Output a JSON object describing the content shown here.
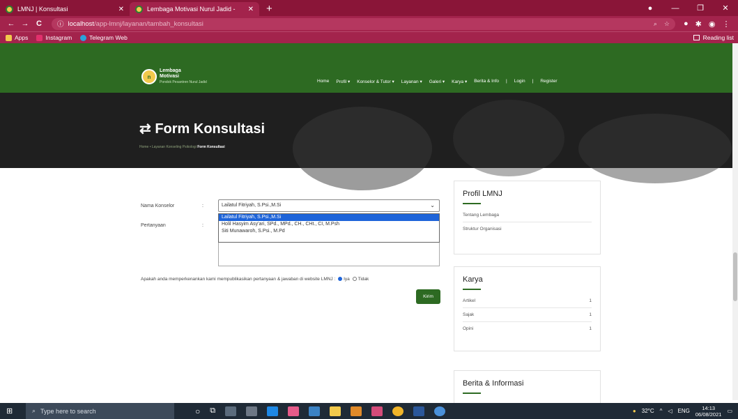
{
  "browser": {
    "tabs": [
      {
        "title": "LMNJ | Konsultasi"
      },
      {
        "title": "Lembaga Motivasi Nurul Jadid - "
      }
    ],
    "address": {
      "host": "localhost",
      "path": "/app-lmnj/layanan/tambah_konsultasi"
    },
    "bookmarks": [
      {
        "label": "Apps",
        "color": "#f2c94c"
      },
      {
        "label": "Instagram",
        "color": "#e1306c"
      },
      {
        "label": "Telegram Web",
        "color": "#2aa1da"
      }
    ],
    "reading_list": "Reading list"
  },
  "site": {
    "logo": {
      "line1": "Lembaga",
      "line2": "Motivasi",
      "line3": "Pondok Pesantren Nurul Jadid"
    },
    "menu": [
      "Home",
      "Profil ▾",
      "Konselor & Tutor ▾",
      "Layanan ▾",
      "Galeri ▾",
      "Karya ▾",
      "Berita & Info",
      "|",
      "Login",
      "|",
      "Register"
    ],
    "hero_title": "⇄ Form Konsultasi",
    "breadcrumb": {
      "prefix": "Home • Layanan Konseling Psikologi",
      "current": "Form Konsultasi"
    }
  },
  "form": {
    "konselor_label": "Nama Konselor",
    "pertanyaan_label": "Pertanyaan",
    "colon": ":",
    "selected": "Lailatul Fitriyah, S.Psi.,M.Si",
    "options": [
      "Lailatul Fitriyah, S.Psi.,M.Si",
      "Holil Hasyim Asy'ari, SPd., MPd., CH., CHt., CI, M.Psh",
      "Siti Munawaroh, S.Psi., M.Pd"
    ],
    "consent_text": "Apakah anda memperkenankan kami mempublikasikan pertanyaan & jawaban di website LMNJ :",
    "yes": "Iya",
    "no": "Tidak",
    "submit": "Kirim"
  },
  "sidebar": {
    "profil": {
      "title": "Profil LMNJ",
      "items": [
        "Tentang Lembaga",
        "Struktur Organisasi"
      ]
    },
    "karya": {
      "title": "Karya",
      "items": [
        {
          "label": "Artikel",
          "count": "1"
        },
        {
          "label": "Sajak",
          "count": "1"
        },
        {
          "label": "Opini",
          "count": "1"
        }
      ]
    },
    "berita": {
      "title": "Berita & Informasi"
    }
  },
  "taskbar": {
    "search_placeholder": "Type here to search",
    "weather": "32°C",
    "lang": "ENG",
    "time": "14:13",
    "date": "06/08/2021"
  }
}
